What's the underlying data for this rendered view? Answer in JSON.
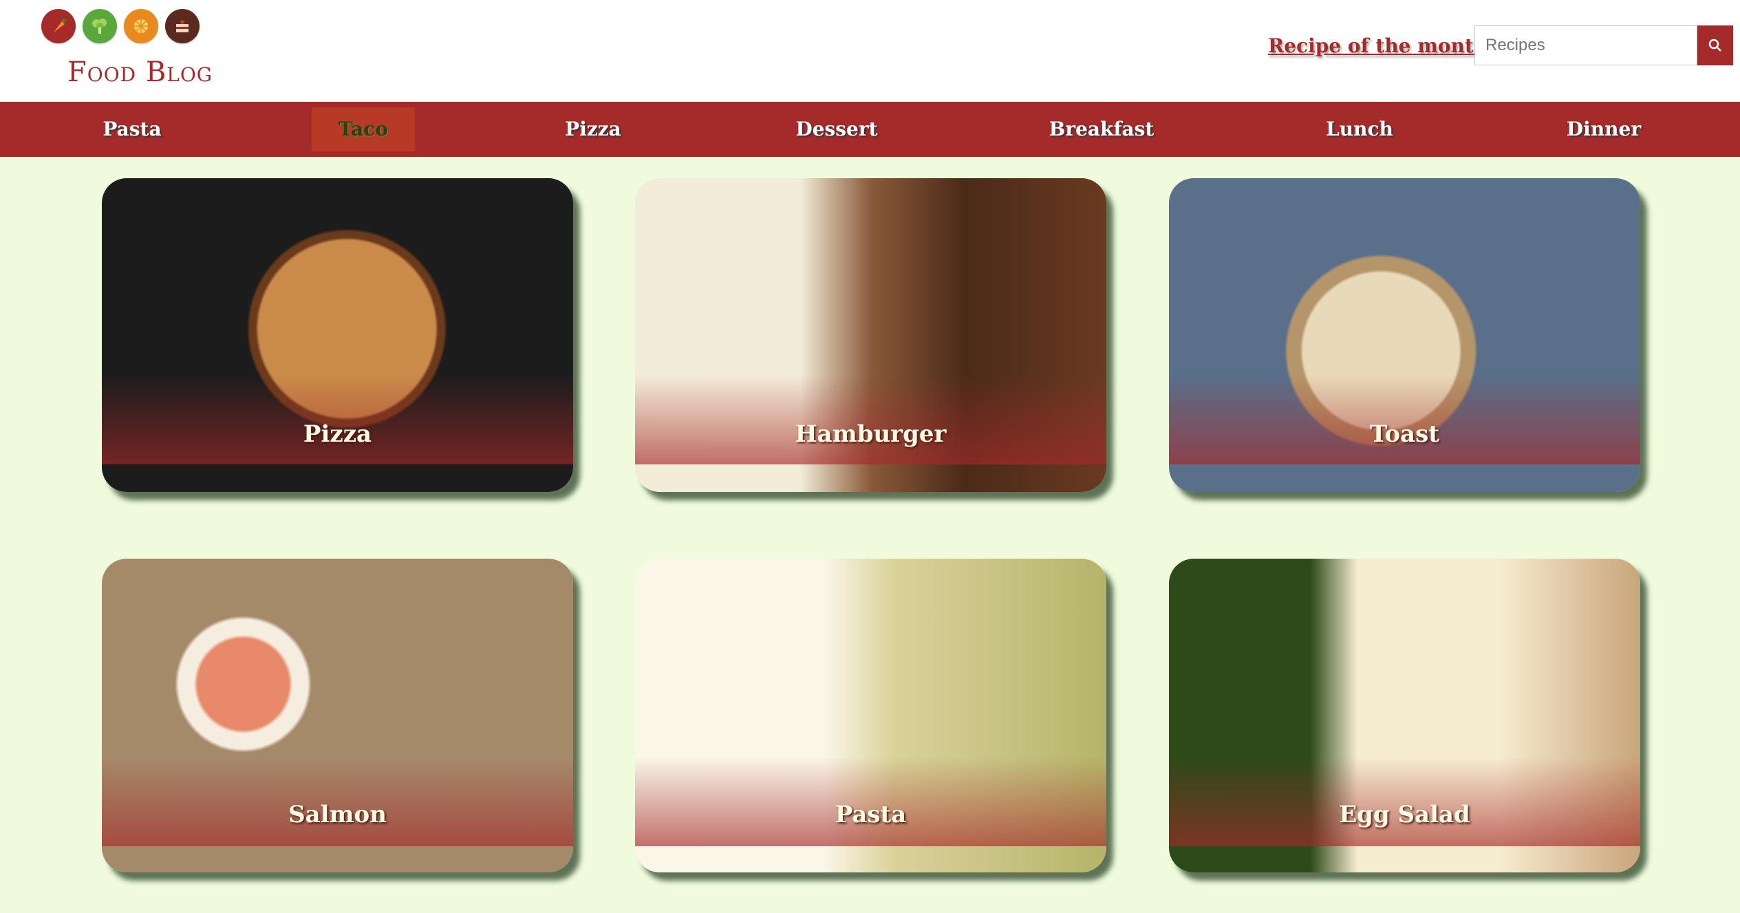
{
  "header": {
    "logo_icons": [
      "carrot-icon",
      "broccoli-icon",
      "orange-icon",
      "cake-icon"
    ],
    "brand": "Food Blog",
    "month_link": "Recipe of the month",
    "search": {
      "placeholder": "Recipes",
      "value": ""
    },
    "search_button_icon": "search-icon"
  },
  "nav": {
    "items": [
      {
        "label": "Pasta"
      },
      {
        "label": "Taco",
        "active": true
      },
      {
        "label": "Pizza"
      },
      {
        "label": "Dessert"
      },
      {
        "label": "Breakfast"
      },
      {
        "label": "Lunch"
      },
      {
        "label": "Dinner"
      }
    ]
  },
  "cards": [
    {
      "label": "Pizza"
    },
    {
      "label": "Hamburger"
    },
    {
      "label": "Toast"
    },
    {
      "label": "Salmon"
    },
    {
      "label": "Pasta"
    },
    {
      "label": "Egg Salad"
    }
  ],
  "colors": {
    "accent": "#a52a2a",
    "background": "#effbdc",
    "header": "#ffffff"
  }
}
